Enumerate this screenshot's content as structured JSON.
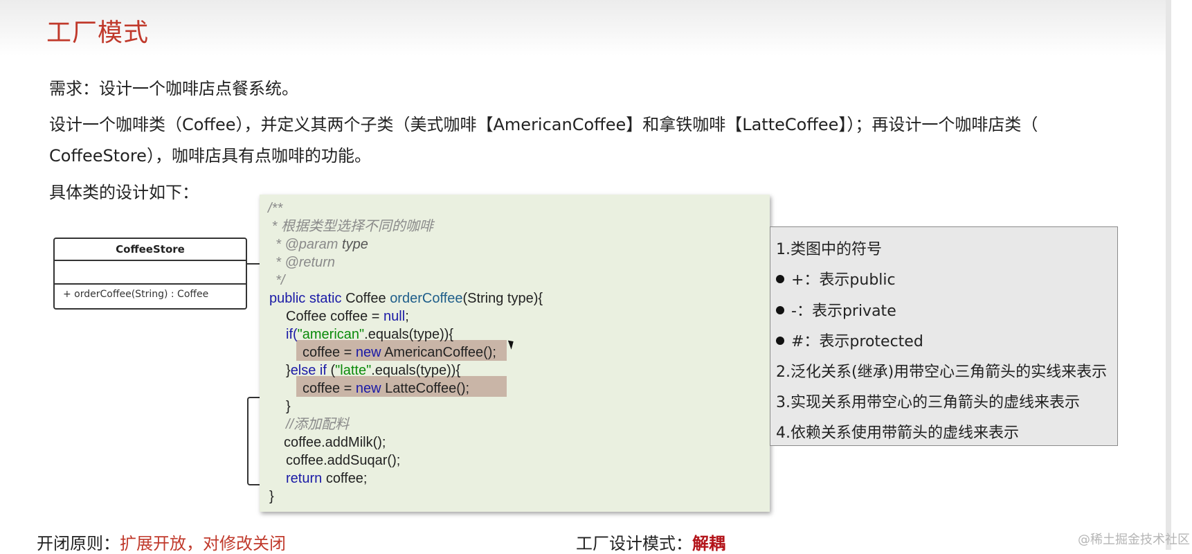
{
  "title": "工厂模式",
  "paragraphs": {
    "requirement": "需求：设计一个咖啡店点餐系统。",
    "line1": "设计一个咖啡类（Coffee），并定义其两个子类（美式咖啡【AmericanCoffee】和拿铁咖啡【LatteCoffee】）；再设计一个咖啡店类（",
    "line2": "CoffeeStore），咖啡店具有点咖啡的功能。",
    "line3": "具体类的设计如下："
  },
  "uml": {
    "class_name": "CoffeeStore",
    "method": "+ orderCoffee(String) : Coffee"
  },
  "code": {
    "c1": "/**",
    "c2": " * 根据类型选择不同的咖啡",
    "c3a": "  * @param ",
    "c3b": "type",
    "c4": "  * @return",
    "c5": "  */",
    "l6a": "public static ",
    "l6b": "Coffee ",
    "l6c": "orderCoffee",
    "l6d": "(String type){",
    "l7a": "Coffee coffee = ",
    "l7b": "null",
    "l7c": ";",
    "l8a": "if(",
    "l8b": "\"american\"",
    "l8c": ".equals(type)){",
    "l9a": "coffee = ",
    "l9b": "new ",
    "l9c": "AmericanCoffee();",
    "l10a": "}",
    "l10b": "else if ",
    "l10c": "(",
    "l10d": "\"latte\"",
    "l10e": ".equals(type)){",
    "l11a": "coffee = ",
    "l11b": "new ",
    "l11c": "LatteCoffee();",
    "l12": "}",
    "l13": "//添加配料",
    "l14": "coffee.addMilk();",
    "l15": "coffee.addSuqar();",
    "l16a": "return ",
    "l16b": "coffee;",
    "l17": "}"
  },
  "notes": {
    "n1": "1.类图中的符号",
    "n2": "+：表示public",
    "n3": "-：表示private",
    "n4": "#：表示protected",
    "n5": "2.泛化关系(继承)用带空心三角箭头的实线来表示",
    "n6": "3.实现关系用带空心的三角箭头的虚线来表示",
    "n7": "4.依赖关系使用带箭头的虚线来表示"
  },
  "bottom": {
    "principle_label": "开闭原则：",
    "principle_value": "扩展开放，对修改关闭",
    "factory_label": "工厂设计模式：",
    "factory_value": "解耦"
  },
  "watermark": "@稀土掘金技术社区",
  "colors": {
    "title": "#c0392b",
    "keyword": "#1a1aa6",
    "string": "#0a8a0a",
    "comment": "#8a8a8a",
    "highlight": "#c9b5a7",
    "code_bg": "#eaf0e0"
  }
}
